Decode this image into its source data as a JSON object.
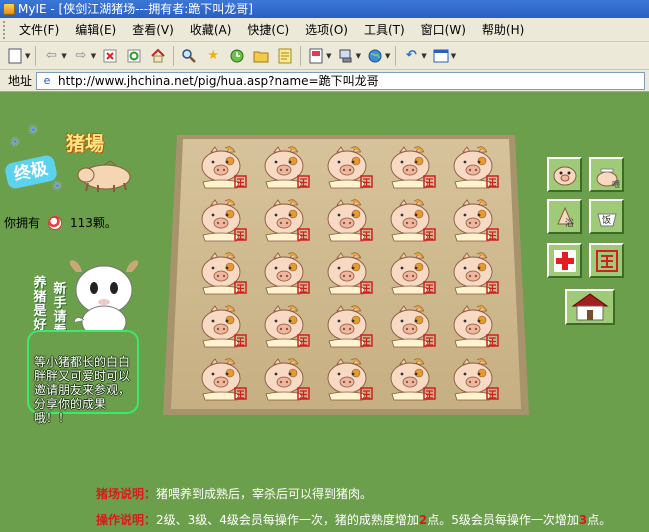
{
  "window": {
    "title": "MyIE - [侠剑江湖猪场---拥有者:跪下叫龙哥]"
  },
  "menu": [
    {
      "label": "文件(F)"
    },
    {
      "label": "编辑(E)"
    },
    {
      "label": "查看(V)"
    },
    {
      "label": "收藏(A)"
    },
    {
      "label": "快捷(C)"
    },
    {
      "label": "选项(O)"
    },
    {
      "label": "工具(T)"
    },
    {
      "label": "窗口(W)"
    },
    {
      "label": "帮助(H)"
    }
  ],
  "toolbar": {
    "icons": [
      "new-page-icon",
      "back-icon",
      "forward-icon",
      "stop-icon",
      "refresh-icon",
      "home-icon",
      "search-icon",
      "favorites-star-icon",
      "history-icon",
      "folder-icon",
      "notes-icon",
      "page-icon",
      "proxy-icon",
      "globe-icon",
      "undo-icon",
      "window-icon"
    ]
  },
  "address": {
    "label": "地址",
    "url": "http://www.jhchina.net/pig/hua.asp?name=跪下叫龙哥"
  },
  "page": {
    "logo_badge": "终极",
    "logo_title": "猪場",
    "owned_prefix": "你拥有",
    "owned_count": "113颗。",
    "vertical_left": "养猪是好娱乐",
    "vertical_right": "新手请看",
    "bubble_text": "等小猪都长的白白胖胖又可爱时可以邀请朋友来参观，分享你的成果哦！！",
    "pig_grid": {
      "rows": 5,
      "cols": 5
    },
    "actions": [
      {
        "name": "pig-face-action",
        "icon": "pig-face-icon"
      },
      {
        "name": "feed-action",
        "icon": "feed-icon"
      },
      {
        "name": "bath-action",
        "icon": "bath-icon"
      },
      {
        "name": "food-bowl-action",
        "icon": "food-bowl-icon"
      },
      {
        "name": "medic-action",
        "icon": "red-cross-icon"
      },
      {
        "name": "stamp-action",
        "icon": "stamp-icon"
      }
    ],
    "note1_label": "猪场说明：",
    "note1_text": "猪喂养到成熟后，宰杀后可以得到猪肉。",
    "note2_label": "操作说明：",
    "note2_a": "2级、3级、4级会员每操作一次，猪的成熟度增加",
    "note2_b": "2",
    "note2_c": "点。5级会员每操作一次增加",
    "note2_d": "3",
    "note2_e": "点。"
  },
  "colors": {
    "background": "#6c9f4c",
    "field_floor": "#c9b48a",
    "highlight_red": "#d61c1c",
    "bubble_border": "#3ce86e"
  }
}
